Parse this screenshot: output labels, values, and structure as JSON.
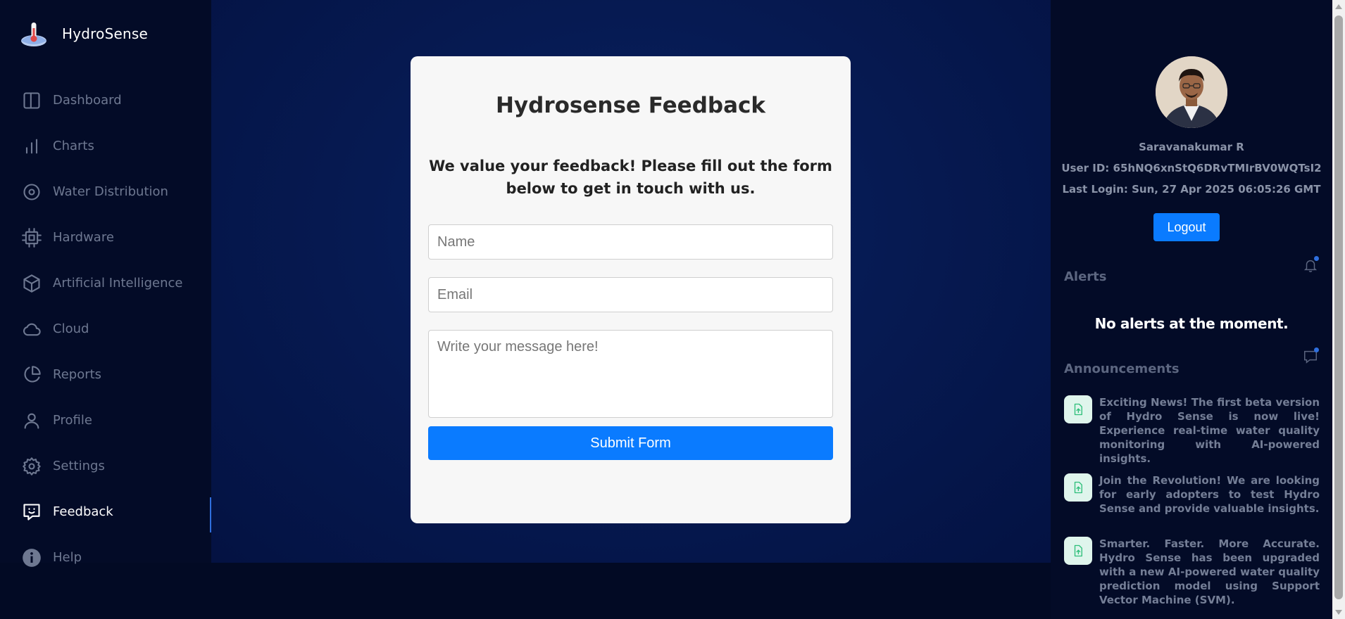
{
  "app": {
    "name": "HydroSense"
  },
  "sidebar": {
    "items": [
      {
        "label": "Dashboard",
        "icon": "dashboard-icon",
        "active": false
      },
      {
        "label": "Charts",
        "icon": "chart-icon",
        "active": false
      },
      {
        "label": "Water Distribution",
        "icon": "target-icon",
        "active": false
      },
      {
        "label": "Hardware",
        "icon": "cpu-icon",
        "active": false
      },
      {
        "label": "Artificial Intelligence",
        "icon": "cube-icon",
        "active": false
      },
      {
        "label": "Cloud",
        "icon": "cloud-icon",
        "active": false
      },
      {
        "label": "Reports",
        "icon": "pie-chart-icon",
        "active": false
      },
      {
        "label": "Profile",
        "icon": "user-icon",
        "active": false
      },
      {
        "label": "Settings",
        "icon": "gear-icon",
        "active": false
      },
      {
        "label": "Feedback",
        "icon": "feedback-icon",
        "active": true
      },
      {
        "label": "Help",
        "icon": "info-icon",
        "active": false
      }
    ]
  },
  "form": {
    "title": "Hydrosense Feedback",
    "description": "We value your feedback! Please fill out the form below to get in touch with us.",
    "name_placeholder": "Name",
    "email_placeholder": "Email",
    "message_placeholder": "Write your message here!",
    "submit_label": "Submit Form"
  },
  "user": {
    "name": "Saravanakumar R",
    "user_id": "User ID: 65hNQ6xnStQ6DRvTMIrBV0WQTsI2",
    "last_login": "Last Login: Sun, 27 Apr 2025 06:05:26 GMT",
    "logout_label": "Logout"
  },
  "alerts": {
    "title": "Alerts",
    "empty_text": "No alerts at the moment."
  },
  "announcements": {
    "title": "Announcements",
    "items": [
      {
        "text": "Exciting News! The first beta version of Hydro Sense is now live! Experience real-time water quality monitoring with AI-powered insights."
      },
      {
        "text": "Join the Revolution! We are looking for early adopters to test Hydro Sense and provide valuable insights."
      },
      {
        "text": "Smarter. Faster. More Accurate. Hydro Sense has been upgraded with a new AI-powered water quality prediction model using Support Vector Machine (SVM)."
      }
    ]
  },
  "colors": {
    "accent": "#0a7bff",
    "sidebar_bg": "#030b27",
    "main_bg": "#061a52",
    "card_bg": "#f7f7f7"
  }
}
